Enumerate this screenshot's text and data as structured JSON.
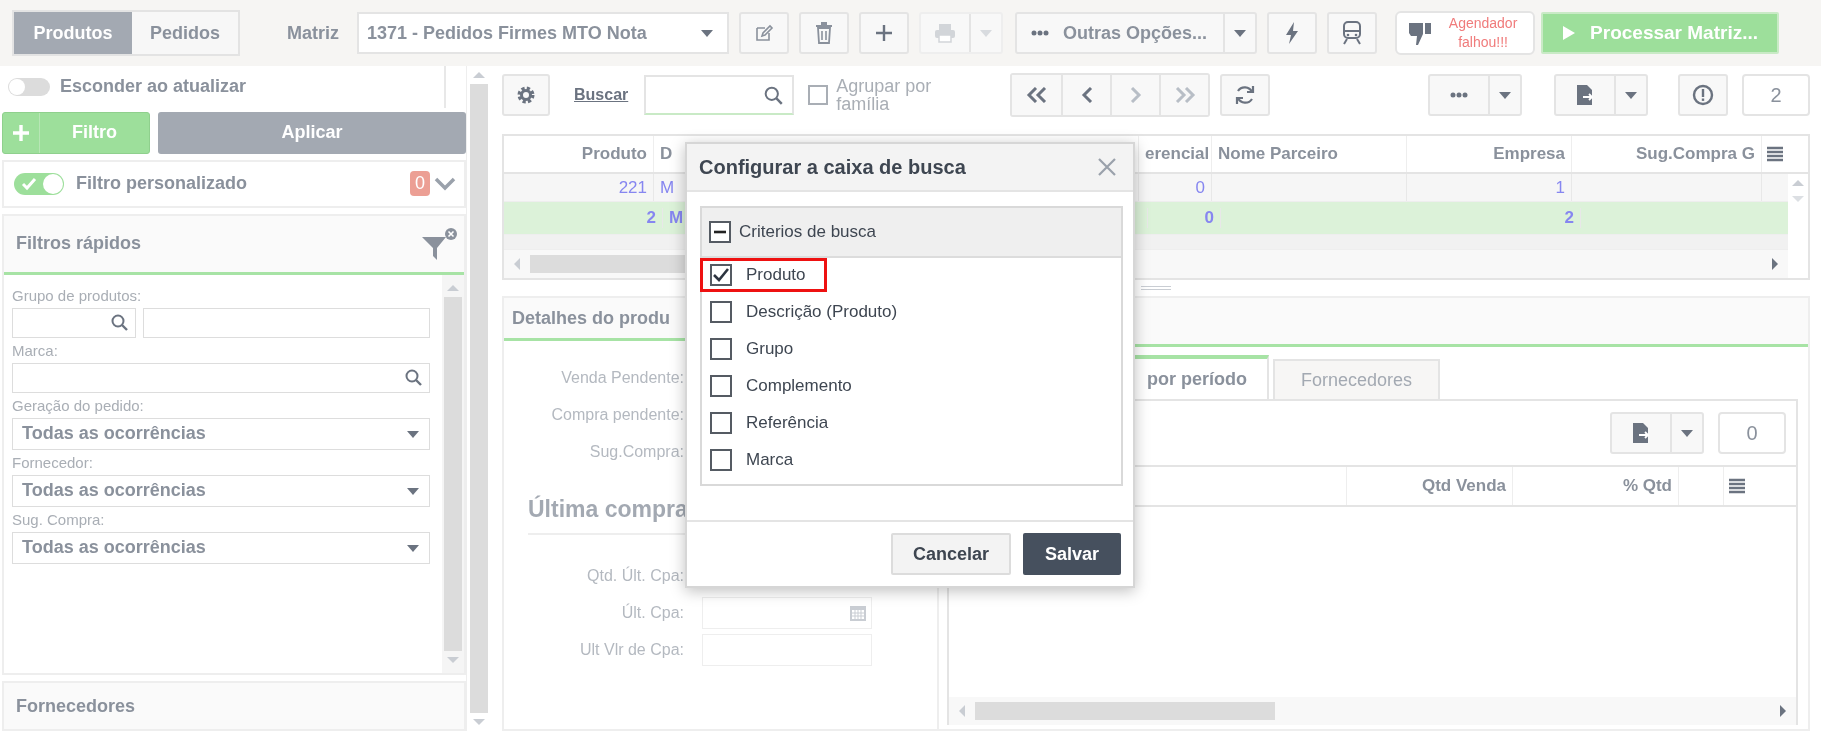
{
  "top_tabs": [
    {
      "label": "Produtos",
      "selected": true
    },
    {
      "label": "Pedidos",
      "selected": false
    }
  ],
  "matriz": {
    "label": "Matriz",
    "value": "1371 - Pedidos Firmes MTO Nota"
  },
  "print_button": {
    "disabled": true
  },
  "more_options": "Outras Opções...",
  "scheduler_status": "Agendador falhou!!!",
  "process_button": "Processar Matriz...",
  "sidebar": {
    "hide_on_update": {
      "label": "Esconder ao atualizar",
      "on": false
    },
    "filter_button": "Filtro",
    "apply_button": "Aplicar",
    "custom_filter": {
      "label": "Filtro personalizado",
      "on": true,
      "count": "0"
    },
    "quick_filters": {
      "title": "Filtros rápidos",
      "fields": [
        {
          "kind": "lookup",
          "label": "Grupo de produtos:"
        },
        {
          "kind": "search",
          "label": "Marca:"
        },
        {
          "kind": "select",
          "label": "Geração do pedido:",
          "value": "Todas as ocorrências"
        },
        {
          "kind": "select",
          "label": "Fornecedor:",
          "value": "Todas as ocorrências"
        },
        {
          "kind": "select",
          "label": "Sug. Compra:",
          "value": "Todas as ocorrências"
        }
      ]
    },
    "suppliers_section": "Fornecedores"
  },
  "search_bar": {
    "link": "Buscar",
    "group_by_family": {
      "label": "Agrupar por família",
      "checked": false
    }
  },
  "record_count": "2",
  "grid": {
    "columns": [
      "Produto",
      "D",
      "erencial",
      "Nome Parceiro",
      "Empresa",
      "Sug.Compra G"
    ],
    "rows": [
      {
        "cells": [
          "221",
          "M",
          "0",
          "",
          "1",
          ""
        ],
        "selected": false
      },
      {
        "cells": [
          "2",
          "M",
          "0",
          "",
          "2",
          ""
        ],
        "selected": true
      }
    ]
  },
  "details": {
    "title": "Detalhes do produ",
    "labels": [
      "Venda Pendente:",
      "Compra pendente:",
      "Sug.Compra:"
    ],
    "last_purchase": {
      "title": "Última compra",
      "quantity_label": "Qtd. Últ. Cpa:",
      "fields": [
        {
          "kind": "date",
          "label": "Últ. Cpa:"
        },
        {
          "kind": "input",
          "label": "Ult Vlr de Cpa:"
        }
      ]
    }
  },
  "sales_panel": {
    "tabs": [
      {
        "label": "por período",
        "selected": true
      },
      {
        "label": "Fornecedores",
        "selected": false
      }
    ],
    "record_count": "0",
    "columns": [
      "Qtd Venda",
      "% Qtd"
    ]
  },
  "dialog": {
    "title": "Configurar a caixa de busca",
    "tree": {
      "label": "Criterios de busca",
      "expanded": true,
      "items": [
        {
          "label": "Produto",
          "checked": true,
          "highlighted": true
        },
        {
          "label": "Descrição (Produto)",
          "checked": false,
          "highlighted": false
        },
        {
          "label": "Grupo",
          "checked": false,
          "highlighted": false
        },
        {
          "label": "Complemento",
          "checked": false,
          "highlighted": false
        },
        {
          "label": "Referência",
          "checked": false,
          "highlighted": false
        },
        {
          "label": "Marca",
          "checked": false,
          "highlighted": false
        }
      ]
    },
    "cancel_button": "Cancelar",
    "save_button": "Salvar"
  }
}
